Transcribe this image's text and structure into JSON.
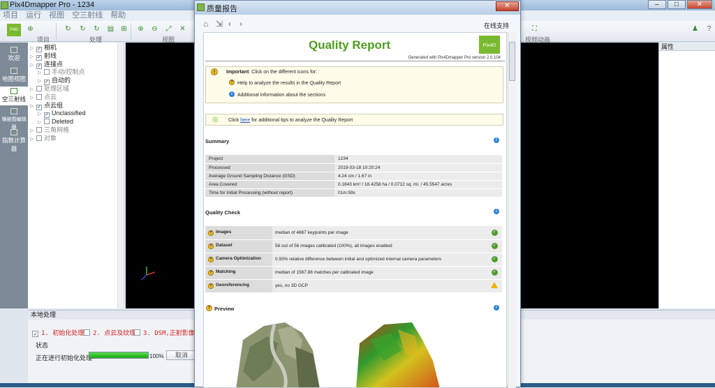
{
  "app": {
    "title": "Pix4Dmapper Pro - 1234"
  },
  "menu": [
    "项目",
    "运行",
    "视图",
    "空三射线",
    "帮助"
  ],
  "ribbon": {
    "groups": [
      "项目",
      "处理",
      "视图",
      "视频动画"
    ]
  },
  "leftnav": [
    {
      "label": "欢迎"
    },
    {
      "label": "地图视图"
    },
    {
      "label": "空三射线"
    },
    {
      "label": "镶嵌图编辑器"
    },
    {
      "label": "指数计算器"
    }
  ],
  "tree": [
    {
      "label": "相机",
      "checked": true,
      "indent": 0
    },
    {
      "label": "射线",
      "checked": true,
      "indent": 0
    },
    {
      "label": "连接点",
      "checked": true,
      "indent": 0
    },
    {
      "label": "手动/控制点",
      "checked": false,
      "indent": 1,
      "dim": true
    },
    {
      "label": "自动的",
      "checked": true,
      "indent": 1
    },
    {
      "label": "处理区域",
      "checked": false,
      "indent": 0,
      "dim": true
    },
    {
      "label": "点云",
      "checked": false,
      "indent": 0,
      "dim": true
    },
    {
      "label": "点云组",
      "checked": true,
      "indent": 0
    },
    {
      "label": "Unclassified",
      "checked": true,
      "indent": 1
    },
    {
      "label": "Deleted",
      "checked": false,
      "indent": 1
    },
    {
      "label": "三角网格",
      "checked": false,
      "indent": 0,
      "dim": true
    },
    {
      "label": "对象",
      "checked": false,
      "indent": 0,
      "dim": true
    }
  ],
  "props": {
    "title": "属性"
  },
  "processing": {
    "title": "本地处理",
    "steps": [
      "1. 初始化处理",
      "2. 点云及纹理",
      "3. DSM,正射影像图"
    ],
    "status_label": "状态",
    "current": "正在进行初始化处理",
    "progress": 100,
    "progress_text": "100%",
    "cancel": "取消"
  },
  "dialog": {
    "title": "质量报告",
    "online": "在线支持",
    "report": {
      "heading": "Quality Report",
      "generated": "Generated with Pix4Dmapper Pro version 2.0.104",
      "important_lead": "Important",
      "important_text": ": Click on the different icons for:",
      "help1": "Help to analyze the results in the Quality Report",
      "help2": "Additional information about the sections",
      "tip_pre": "Click ",
      "tip_link": "here",
      "tip_post": " for additional tips to analyze the Quality Report",
      "summary_title": "Summary",
      "summary": [
        [
          "Project",
          "1234"
        ],
        [
          "Processed",
          "2019-03-18 10:20:24"
        ],
        [
          "Average Ground Sampling Distance (GSD)",
          "4.24 cm / 1.67 in"
        ],
        [
          "Area Covered",
          "0.1843 km² / 18.4258 ha / 0.0712 sq. mi. / 45.5547 acres"
        ],
        [
          "Time for Initial Processing (without report)",
          "01m:59s"
        ]
      ],
      "qc_title": "Quality Check",
      "qc": [
        {
          "k": "Images",
          "v": "median of 4867 keypoints per image",
          "status": "ok"
        },
        {
          "k": "Dataset",
          "v": "56 out of 56 images calibrated (100%), all images enabled",
          "status": "ok"
        },
        {
          "k": "Camera Optimization",
          "v": "0.93% relative difference between initial and optimized internal camera parameters",
          "status": "ok"
        },
        {
          "k": "Matching",
          "v": "median of 1567.88 matches per calibrated image",
          "status": "ok"
        },
        {
          "k": "Georeferencing",
          "v": "yes, no 3D GCP",
          "status": "warn"
        }
      ],
      "preview_title": "Preview",
      "logo_text": "Pix4D"
    }
  }
}
